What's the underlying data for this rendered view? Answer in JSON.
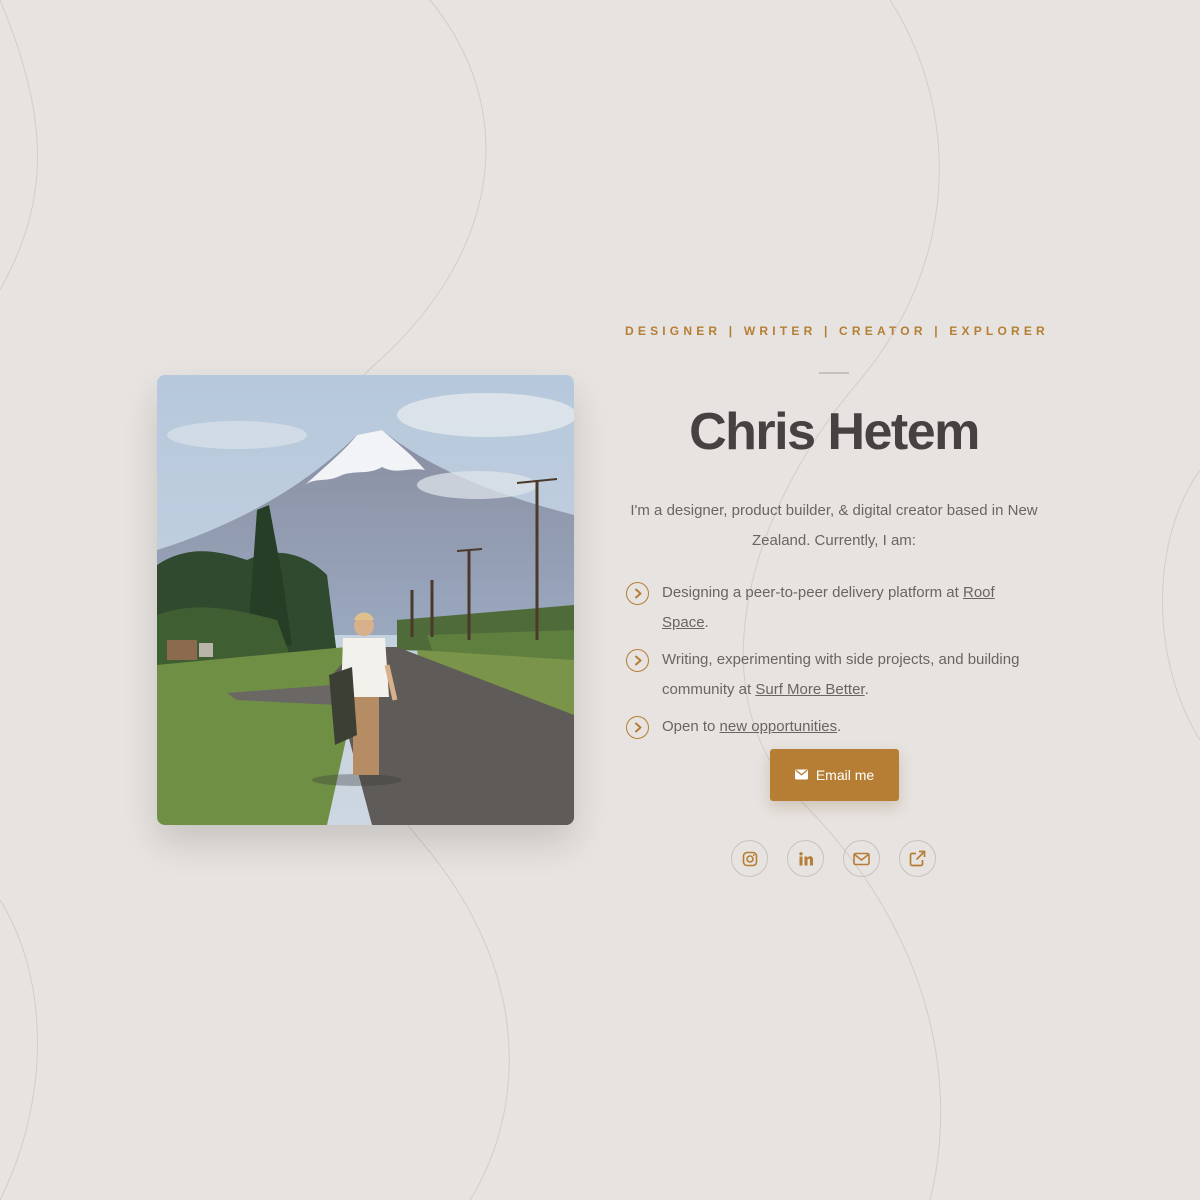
{
  "header": {
    "tagline": "DESIGNER | WRITER | CREATOR | EXPLORER",
    "name": "Chris Hetem"
  },
  "intro": "I'm a designer, product builder, & digital creator based in New Zealand. Currently, I am:",
  "bullets": [
    {
      "before": "Designing a peer-to-peer delivery platform at ",
      "link": "Roof Space",
      "after": "."
    },
    {
      "before": "Writing, experimenting with side projects, and building community at ",
      "link": "Surf More Better",
      "after": "."
    },
    {
      "before": "Open to ",
      "link": "new opportunities",
      "after": "."
    }
  ],
  "cta": {
    "label": "Email me",
    "icon": "envelope-icon"
  },
  "socials": [
    {
      "name": "instagram-icon"
    },
    {
      "name": "linkedin-icon"
    },
    {
      "name": "mail-icon"
    },
    {
      "name": "external-link-icon"
    }
  ],
  "colors": {
    "background": "#e7e3e0",
    "accent": "#b67e34",
    "heading": "#454241",
    "body_text": "#6a6563"
  }
}
